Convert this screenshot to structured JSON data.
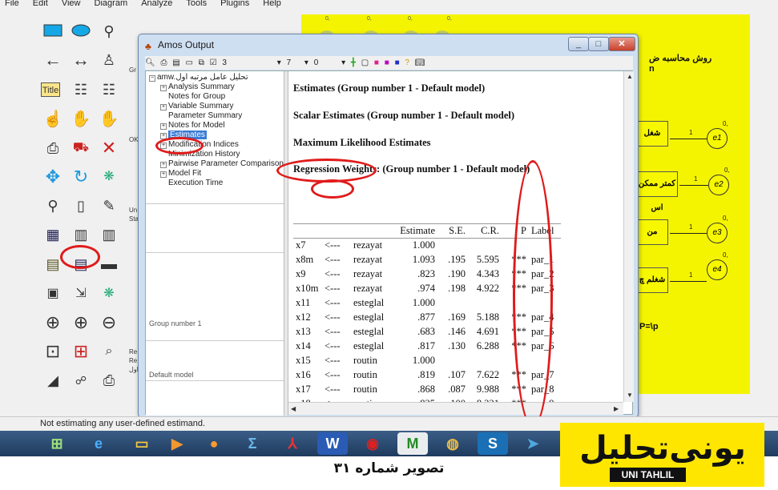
{
  "menubar": [
    "File",
    "Edit",
    "View",
    "Diagram",
    "Analyze",
    "Tools",
    "Plugins",
    "Help"
  ],
  "window": {
    "title": "Amos Output",
    "toolbar": {
      "spin1_value": "3",
      "spin2_value": "7",
      "spin3_value": "0"
    }
  },
  "tree": {
    "root": "amw.تحلیل عامل مرتبه اول",
    "items": [
      "Analysis Summary",
      "Notes for Group",
      "Variable Summary",
      "Parameter Summary",
      "Notes for Model",
      "Estimates",
      "Modification Indices",
      "Minimization History",
      "Pairwise Parameter Comparisons",
      "Model Fit",
      "Execution Time"
    ],
    "group_label": "Group number 1",
    "model_label": "Default model"
  },
  "content": {
    "h1": "Estimates (Group number 1 - Default model)",
    "h2": "Scalar Estimates (Group number 1 - Default model)",
    "h3": "Maximum Likelihood Estimates",
    "h4": "Regression Weights: (Group number 1 - Default model)",
    "columns": [
      "",
      "",
      "",
      "Estimate",
      "S.E.",
      "C.R.",
      "P",
      "Label"
    ],
    "rows": [
      [
        "x7",
        "<---",
        "rezayat",
        "1.000",
        "",
        "",
        "",
        ""
      ],
      [
        "x8m",
        "<---",
        "rezayat",
        "1.093",
        ".195",
        "5.595",
        "***",
        "par_1"
      ],
      [
        "x9",
        "<---",
        "rezayat",
        ".823",
        ".190",
        "4.343",
        "***",
        "par_2"
      ],
      [
        "x10m",
        "<---",
        "rezayat",
        ".974",
        ".198",
        "4.922",
        "***",
        "par_3"
      ],
      [
        "x11",
        "<---",
        "esteglal",
        "1.000",
        "",
        "",
        "",
        ""
      ],
      [
        "x12",
        "<---",
        "esteglal",
        ".877",
        ".169",
        "5.188",
        "***",
        "par_4"
      ],
      [
        "x13",
        "<---",
        "esteglal",
        ".683",
        ".146",
        "4.691",
        "***",
        "par_5"
      ],
      [
        "x14",
        "<---",
        "esteglal",
        ".817",
        ".130",
        "6.288",
        "***",
        "par_6"
      ],
      [
        "x15",
        "<---",
        "routin",
        "1.000",
        "",
        "",
        "",
        ""
      ],
      [
        "x16",
        "<---",
        "routin",
        ".819",
        ".107",
        "7.622",
        "***",
        "par_7"
      ],
      [
        "x17",
        "<---",
        "routin",
        ".868",
        ".087",
        "9.988",
        "***",
        "par_8"
      ],
      [
        "x18",
        "<---",
        "routin",
        ".825",
        ".100",
        "8.221",
        "***",
        "par_9"
      ]
    ]
  },
  "diagram": {
    "top_text": "روش محاسبه ض",
    "top_text2": "n",
    "boxes": [
      "شغل",
      "کمتر ممکن اس",
      "من",
      "شغلم چ"
    ],
    "errors": [
      "e1",
      "e2",
      "e3",
      "e4"
    ],
    "formula": "P=\\p",
    "weights": [
      "1",
      "1",
      "1",
      "1"
    ],
    "zeros": [
      "0,",
      "0,",
      "0,",
      "0,"
    ]
  },
  "left_strip": {
    "gr": "Gr",
    "ok": "OK",
    "un": "Un",
    "sta": "Sta",
    "re1": "Re",
    "re2": "Re",
    "re3": "اول"
  },
  "status": "Not estimating any user-defined estimand.",
  "caption": "تصویر شماره ۳۱",
  "logo": {
    "main": "یونی‌تحلیل",
    "sub": "UNI TAHLIL"
  },
  "colors": {
    "highlight": "#e01b1b",
    "diagram_bg": "#f4f400",
    "selection": "#3a7bd5"
  }
}
